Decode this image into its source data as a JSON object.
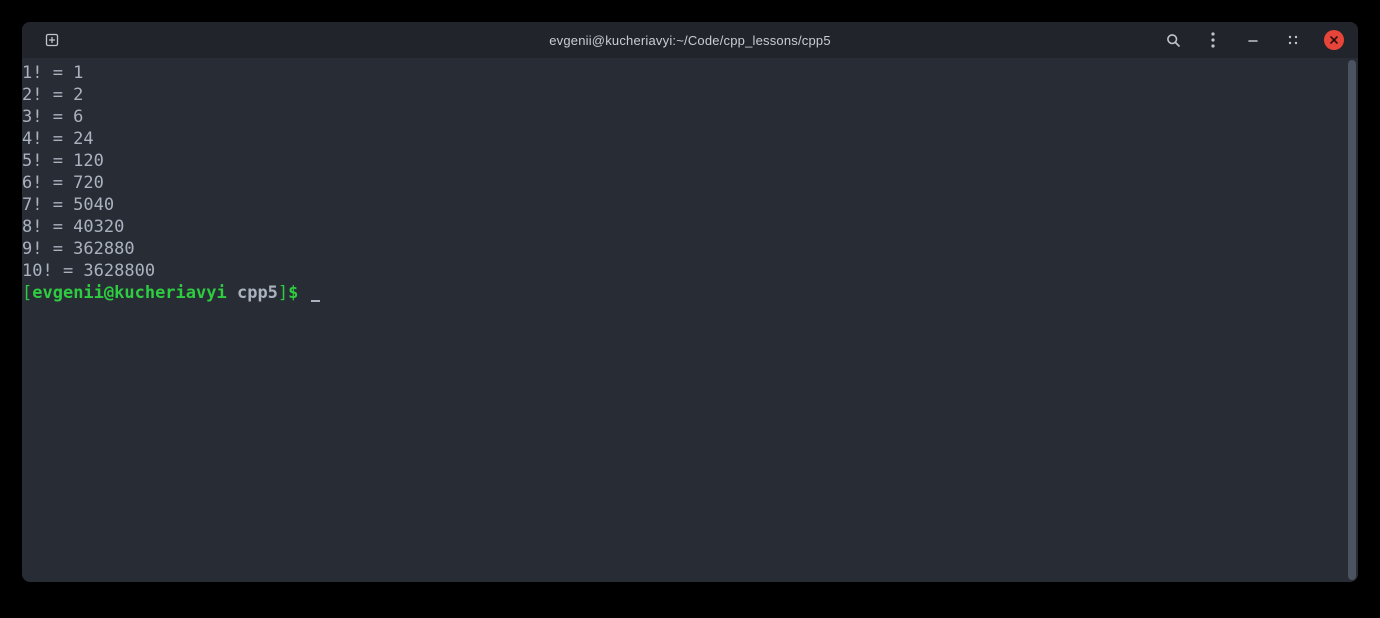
{
  "window": {
    "title": "evgenii@kucheriavyi:~/Code/cpp_lessons/cpp5"
  },
  "output_lines": [
    "1! = 1",
    "2! = 2",
    "3! = 6",
    "4! = 24",
    "5! = 120",
    "6! = 720",
    "7! = 5040",
    "8! = 40320",
    "9! = 362880",
    "10! = 3628800"
  ],
  "prompt": {
    "open_bracket": "[",
    "user_host": "evgenii@kucheriavyi",
    "space": " ",
    "dir": "cpp5",
    "close_bracket": "]",
    "dollar": "$"
  }
}
